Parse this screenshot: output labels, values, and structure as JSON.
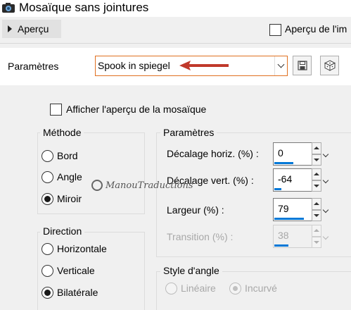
{
  "window": {
    "title": "Mosaïque sans jointures",
    "app_icon": "camera-icon"
  },
  "preview": {
    "toggle_label": "Aperçu",
    "preview_checkbox_label": "Aperçu de l'im",
    "preview_checked": false
  },
  "preset": {
    "label": "Paramètres",
    "value": "Spook in spiegel",
    "save_icon": "save-icon",
    "dice_icon": "dice-icon",
    "annotation_arrow_color": "#c0392b"
  },
  "main": {
    "afficher_label": "Afficher l'aperçu de la mosaïque",
    "afficher_checked": false,
    "methode": {
      "title": "Méthode",
      "options": [
        "Bord",
        "Angle",
        "Miroir"
      ],
      "selected": "Miroir"
    },
    "direction": {
      "title": "Direction",
      "options": [
        "Horizontale",
        "Verticale",
        "Bilatérale"
      ],
      "selected": "Bilatérale"
    },
    "parametres": {
      "title": "Paramètres",
      "fields": [
        {
          "label": "Décalage horiz. (%) :",
          "value": "0",
          "enabled": true,
          "fill": 0.5
        },
        {
          "label": "Décalage vert. (%) :",
          "value": "-64",
          "enabled": true,
          "fill": 0.18
        },
        {
          "label": "Largeur (%) :",
          "value": "79",
          "enabled": true,
          "fill": 0.79
        },
        {
          "label": "Transition (%) :",
          "value": "38",
          "enabled": false,
          "fill": 0.38
        }
      ]
    },
    "style_angle": {
      "title": "Style d'angle",
      "options": [
        "Linéaire",
        "Incurvé"
      ],
      "selected": "Incurvé",
      "enabled": false
    },
    "watermark": "ManouTraductions",
    "accent_color": "#0078d7"
  }
}
